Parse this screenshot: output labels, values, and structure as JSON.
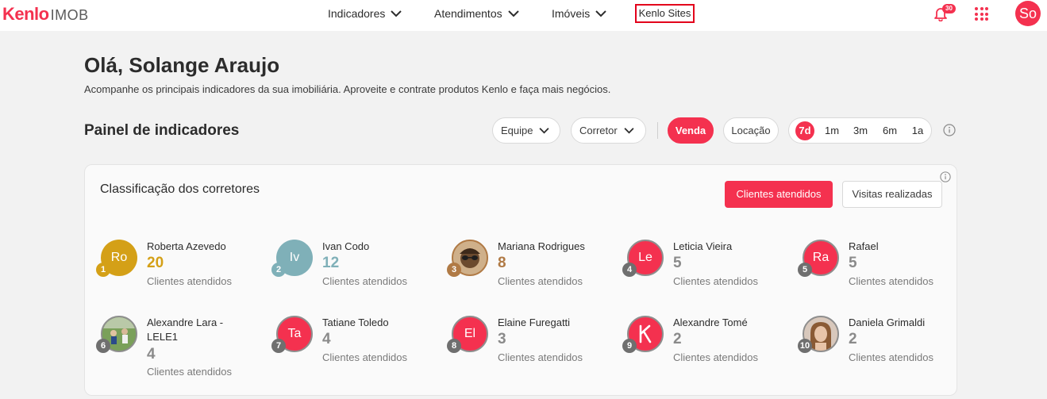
{
  "topbar": {
    "logo_brand": "Kenlo",
    "logo_sub": "IMOB",
    "nav": {
      "indicadores": "Indicadores",
      "atendimentos": "Atendimentos",
      "imoveis": "Imóveis",
      "sites": "Kenlo Sites"
    },
    "notification_count": "30",
    "user_initials": "So"
  },
  "greeting": {
    "title": "Olá, Solange Araujo",
    "subtitle": "Acompanhe os principais indicadores da sua imobiliária. Aproveite e contrate produtos Kenlo e faça mais negócios."
  },
  "panel": {
    "title": "Painel de indicadores",
    "filters": {
      "equipe": "Equipe",
      "corretor": "Corretor"
    },
    "type": {
      "venda": "Venda",
      "locacao": "Locação"
    },
    "periods": [
      "7d",
      "1m",
      "3m",
      "6m",
      "1a"
    ]
  },
  "card": {
    "title": "Classificação dos corretores",
    "btn_primary": "Clientes atendidos",
    "btn_secondary": "Visitas realizadas",
    "metric_label": "Clientes atendidos",
    "rankings": [
      {
        "position": "1",
        "name": "Roberta Azevedo",
        "initials": "Ro",
        "value": "20",
        "avatar": "initials"
      },
      {
        "position": "2",
        "name": "Ivan Codo",
        "initials": "Iv",
        "value": "12",
        "avatar": "initials"
      },
      {
        "position": "3",
        "name": "Mariana Rodrigues",
        "initials": "",
        "value": "8",
        "avatar": "photo"
      },
      {
        "position": "4",
        "name": "Leticia Vieira",
        "initials": "Le",
        "value": "5",
        "avatar": "initials"
      },
      {
        "position": "5",
        "name": "Rafael",
        "initials": "Ra",
        "value": "5",
        "avatar": "initials"
      },
      {
        "position": "6",
        "name": "Alexandre Lara - LELE1",
        "initials": "",
        "value": "4",
        "avatar": "photo"
      },
      {
        "position": "7",
        "name": "Tatiane Toledo",
        "initials": "Ta",
        "value": "4",
        "avatar": "initials"
      },
      {
        "position": "8",
        "name": "Elaine Furegatti",
        "initials": "El",
        "value": "3",
        "avatar": "initials"
      },
      {
        "position": "9",
        "name": "Alexandre Tomé",
        "initials": "",
        "value": "2",
        "avatar": "kenlo-logo-icon"
      },
      {
        "position": "10",
        "name": "Daniela Grimaldi",
        "initials": "",
        "value": "2",
        "avatar": "photo"
      }
    ]
  },
  "colors": {
    "accent": "#f4314f",
    "gold": "#d4a017",
    "teal": "#7fb0b8",
    "bronze": "#b07a45",
    "grey": "#8a8a8a"
  }
}
